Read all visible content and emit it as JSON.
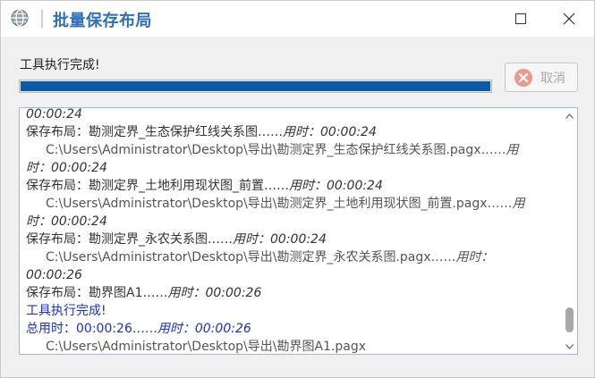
{
  "window": {
    "title": "批量保存布局",
    "accent": "#2e6fb7"
  },
  "status": {
    "message": "工具执行完成!",
    "progress_percent": 100,
    "cancel_label": "取消"
  },
  "log": {
    "lines": [
      {
        "kind": "cont",
        "text": "",
        "time": "00:00:24"
      },
      {
        "kind": "save",
        "text": "保存布局：勘测定界_生态保护红线关系图……",
        "time": "用时：00:00:24"
      },
      {
        "kind": "path",
        "text": "C:\\Users\\Administrator\\Desktop\\导出\\勘测定界_生态保护红线关系图.pagx……",
        "time": "用"
      },
      {
        "kind": "cont",
        "text": "",
        "time": "时：00:00:24"
      },
      {
        "kind": "save",
        "text": "保存布局：勘测定界_土地利用现状图_前置……",
        "time": "用时：00:00:24"
      },
      {
        "kind": "path",
        "text": "C:\\Users\\Administrator\\Desktop\\导出\\勘测定界_土地利用现状图_前置.pagx……",
        "time": "用"
      },
      {
        "kind": "cont",
        "text": "",
        "time": "时：00:00:24"
      },
      {
        "kind": "save",
        "text": "保存布局：勘测定界_永农关系图……",
        "time": "用时：00:00:24"
      },
      {
        "kind": "path",
        "text": "C:\\Users\\Administrator\\Desktop\\导出\\勘测定界_永农关系图.pagx……",
        "time": "用时："
      },
      {
        "kind": "cont",
        "text": "",
        "time": "00:00:26"
      },
      {
        "kind": "save",
        "text": "保存布局：勘界图A1……",
        "time": "用时：00:00:26"
      },
      {
        "kind": "blue",
        "text": "工具执行完成!",
        "time": ""
      },
      {
        "kind": "blue",
        "text": "总用时：00:00:26……",
        "time": "用时：00:00:26"
      },
      {
        "kind": "path",
        "text": "C:\\Users\\Administrator\\Desktop\\导出\\勘界图A1.pagx",
        "time": ""
      }
    ]
  },
  "icons": {
    "app": "globe-icon",
    "maximize": "maximize-icon",
    "close": "close-icon",
    "cancel": "cancel-x-circle-icon",
    "scroll_up": "chevron-up-icon",
    "scroll_down": "chevron-down-icon"
  },
  "colors": {
    "progress": "#0a5aa6",
    "log_blue": "#1a2fd1",
    "cancel_icon": "#e89a8f"
  }
}
